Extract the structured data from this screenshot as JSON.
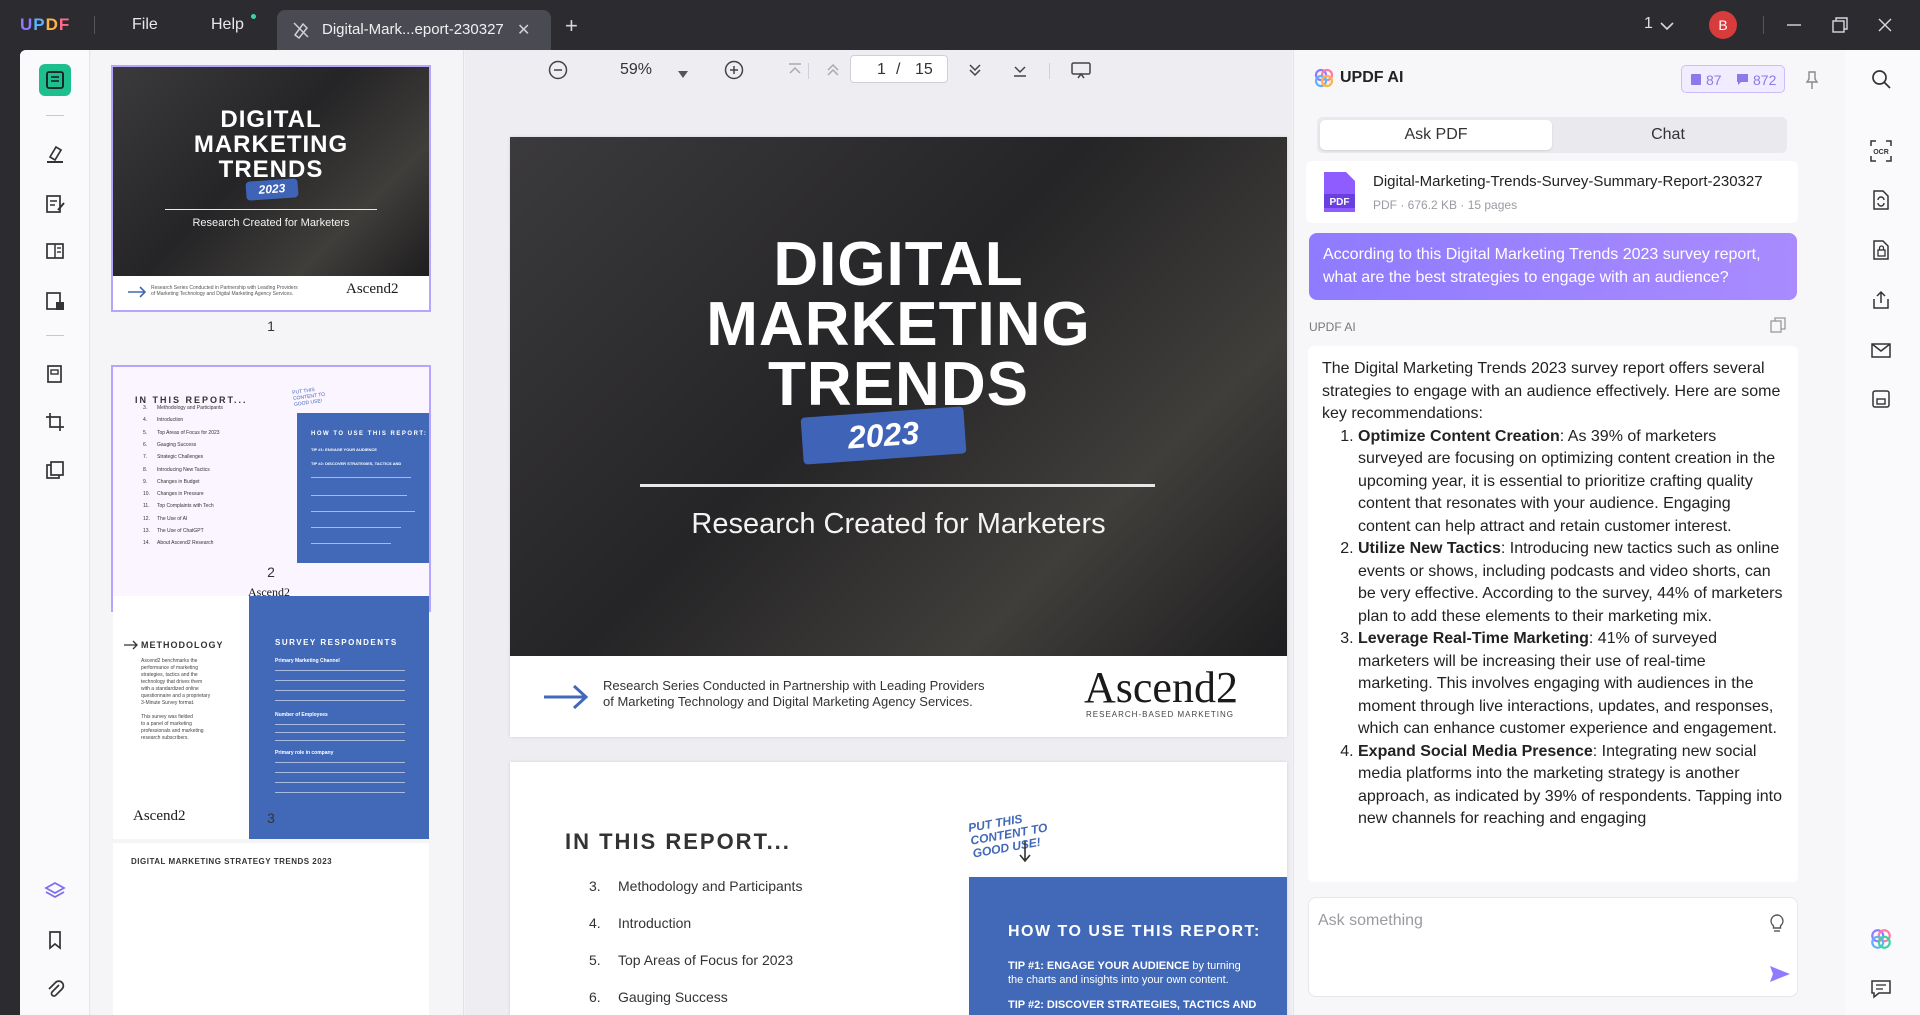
{
  "app": {
    "logo": "UPDF"
  },
  "menu": {
    "file": "File",
    "help": "Help"
  },
  "tab": {
    "title": "Digital-Mark...eport-230327"
  },
  "window": {
    "page_indicator": "1",
    "avatar_letter": "B"
  },
  "viewer": {
    "zoom": "59%",
    "current_page": "1",
    "page_sep": "/",
    "total_pages": "15"
  },
  "cover": {
    "title_line1": "DIGITAL",
    "title_line2": "MARKETING",
    "title_line3": "TRENDS",
    "year": "2023",
    "subtitle": "Research Created for Marketers",
    "footer_line1": "Research Series Conducted in Partnership with Leading Providers",
    "footer_line2": "of Marketing Technology and Digital Marketing Agency Services.",
    "brand": "Ascend2",
    "brand_sub": "RESEARCH-BASED MARKETING"
  },
  "report": {
    "heading": "IN THIS REPORT...",
    "handwritten": "PUT THIS CONTENT TO GOOD USE!",
    "toc": [
      {
        "num": "3.",
        "label": "Methodology and Participants"
      },
      {
        "num": "4.",
        "label": "Introduction"
      },
      {
        "num": "5.",
        "label": "Top Areas of Focus for 2023"
      },
      {
        "num": "6.",
        "label": "Gauging Success"
      },
      {
        "num": "7.",
        "label": "Strategic Challenges"
      },
      {
        "num": "8.",
        "label": "Introducing New Tactics"
      },
      {
        "num": "9.",
        "label": "Changes in Budget"
      },
      {
        "num": "10.",
        "label": "Changes in Pressure"
      },
      {
        "num": "11.",
        "label": "Top Complaints with Tech"
      },
      {
        "num": "12.",
        "label": "The Use of AI"
      },
      {
        "num": "13.",
        "label": "The Use of ChatGPT"
      },
      {
        "num": "14.",
        "label": "About Ascend2 Research"
      }
    ],
    "how_title": "HOW TO USE THIS REPORT:",
    "tip1_bold": "TIP #1: ENGAGE YOUR AUDIENCE",
    "tip1_rest": " by turning",
    "tip1_line2": "the charts and insights into your own content.",
    "tip2": "TIP #2: DISCOVER STRATEGIES, TACTICS AND"
  },
  "thumb3": {
    "methodology": "METHODOLOGY",
    "method_text": [
      "Ascend2 benchmarks the",
      "performance of marketing",
      "strategies, tactics and the",
      "technology that drives them",
      "with a standardized online",
      "questionnaire and a proprietary",
      "3-Minute Survey format.",
      "",
      "This survey was fielded",
      "to a panel of marketing",
      "professionals and marketing",
      "research subscribers."
    ],
    "respondents": "SURVEY RESPONDENTS",
    "sec1": "Primary Marketing Channel",
    "sec2": "Number of Employees",
    "sec3": "Primary role in company"
  },
  "thumb4": {
    "title": "DIGITAL MARKETING STRATEGY TRENDS 2023"
  },
  "thumb_labels": [
    "1",
    "2",
    "3"
  ],
  "ai": {
    "title": "UPDF AI",
    "credits_a": "87",
    "credits_b": "872",
    "tab_ask": "Ask PDF",
    "tab_chat": "Chat",
    "file_name": "Digital-Marketing-Trends-Survey-Summary-Report-230327",
    "file_meta": "PDF · 676.2 KB · 15 pages",
    "question": "According to this Digital Marketing Trends 2023 survey report, what are the best strategies to engage with an audience?",
    "responder": "UPDF AI",
    "intro": "The Digital Marketing Trends 2023 survey report offers several strategies to engage with an audience effectively. Here are some key recommendations:",
    "items": [
      {
        "title": "Optimize Content Creation",
        "text": ": As 39% of marketers surveyed are focusing on optimizing content creation in the upcoming year, it is essential to prioritize crafting quality content that resonates with your audience. Engaging content can help attract and retain customer interest."
      },
      {
        "title": "Utilize New Tactics",
        "text": ": Introducing new tactics such as online events or shows, including podcasts and video shorts, can be very effective. According to the survey, 44% of marketers plan to add these elements to their marketing mix."
      },
      {
        "title": "Leverage Real-Time Marketing",
        "text": ": 41% of surveyed marketers will be increasing their use of real-time marketing. This involves engaging with audiences in the moment through live interactions, updates, and responses, which can enhance customer experience and engagement."
      },
      {
        "title": "Expand Social Media Presence",
        "text": ": Integrating new social media platforms into the marketing strategy is another approach, as indicated by 39% of respondents. Tapping into new channels for reaching and engaging"
      }
    ],
    "ask_placeholder": "Ask something"
  }
}
